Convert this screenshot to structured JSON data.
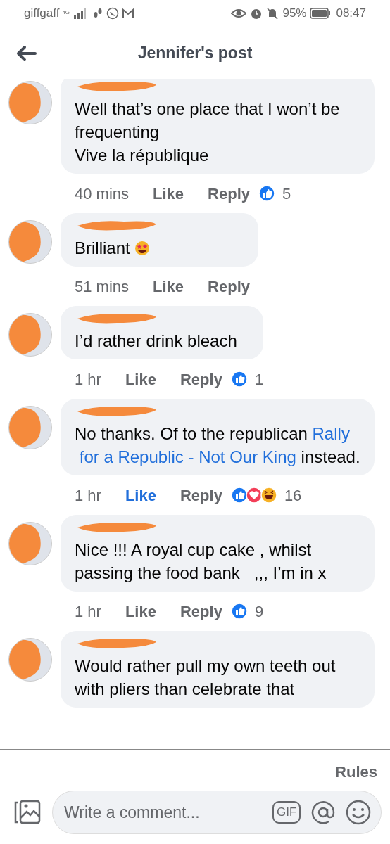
{
  "status_bar": {
    "carrier": "giffgaff",
    "network": "4G",
    "battery": "95%",
    "time": "08:47"
  },
  "header": {
    "title": "Jennifer's post"
  },
  "comments": [
    {
      "segments": [
        {
          "kind": "text",
          "text": "Well that’s one place that I won’t be frequenting\nVive la république"
        }
      ],
      "time": "40 mins",
      "like": "Like",
      "liked": false,
      "reply": "Reply",
      "reactions": [
        {
          "kind": "like"
        }
      ],
      "count": "5"
    },
    {
      "segments": [
        {
          "kind": "text",
          "text": "Brilliant "
        },
        {
          "kind": "emoji"
        }
      ],
      "time": "51 mins",
      "like": "Like",
      "liked": false,
      "reply": "Reply"
    },
    {
      "segments": [
        {
          "kind": "text",
          "text": "I’d rather drink bleach"
        }
      ],
      "time": "1 hr",
      "like": "Like",
      "liked": false,
      "reply": "Reply",
      "reactions": [
        {
          "kind": "like"
        }
      ],
      "count": "1"
    },
    {
      "segments": [
        {
          "kind": "text",
          "text": "No thanks. Of to the republican "
        },
        {
          "kind": "link",
          "text": "Rally"
        },
        {
          "kind": "link",
          "text": "for a Republic - Not Our King"
        },
        {
          "kind": "text",
          "text": " instead."
        }
      ],
      "time": "1 hr",
      "like": "Like",
      "liked": true,
      "reply": "Reply",
      "reactions": [
        {
          "kind": "like"
        },
        {
          "kind": "love"
        },
        {
          "kind": "haha"
        }
      ],
      "count": "16"
    },
    {
      "segments": [
        {
          "kind": "text",
          "text": "Nice !!! A royal cup cake , whilst passing the food bank   ,,, I’m in x"
        }
      ],
      "time": "1 hr",
      "like": "Like",
      "liked": false,
      "reply": "Reply",
      "reactions": [
        {
          "kind": "like"
        }
      ],
      "count": "9"
    },
    {
      "segments": [
        {
          "kind": "text",
          "text": "Would rather pull my own teeth out with pliers than celebrate that"
        }
      ]
    }
  ],
  "footer": {
    "rules": "Rules",
    "placeholder": "Write a comment...",
    "gif": "GIF"
  }
}
